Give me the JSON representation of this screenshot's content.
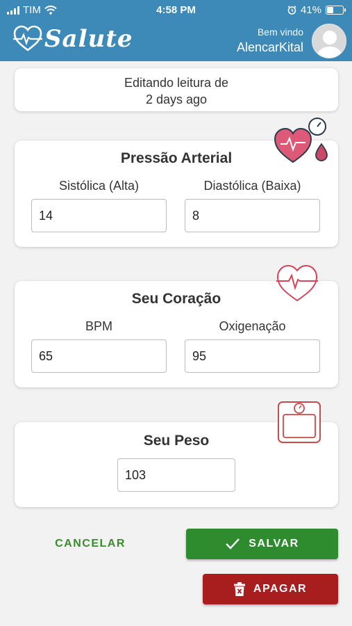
{
  "status_bar": {
    "carrier": "TIM",
    "time": "4:58 PM",
    "battery": "41%",
    "battery_level": 0.41,
    "icons": [
      "signal-icon",
      "wifi-icon",
      "alarm-icon",
      "battery-icon"
    ]
  },
  "header": {
    "app_name": "Salute",
    "welcome": "Bem vindo",
    "username": "AlencarKital",
    "background_color": "#3d8ab8"
  },
  "reading": {
    "line1": "Editando leitura de",
    "line2": "2 days ago"
  },
  "blood_pressure": {
    "title": "Pressão Arterial",
    "systolic_label": "Sistólica (Alta)",
    "systolic_value": "14",
    "diastolic_label": "Diastólica (Baixa)",
    "diastolic_value": "8",
    "icon": "heart-pressure-icon"
  },
  "heart": {
    "title": "Seu Coração",
    "bpm_label": "BPM",
    "bpm_value": "65",
    "oxygen_label": "Oxigenação",
    "oxygen_value": "95",
    "icon": "heartbeat-icon"
  },
  "weight": {
    "title": "Seu Peso",
    "value": "103",
    "icon": "scale-icon"
  },
  "actions": {
    "cancel": "CANCELAR",
    "save": "SALVAR",
    "delete": "APAGAR",
    "save_color": "#2e8b2e",
    "delete_color": "#a81d1d",
    "cancel_color": "#3a8a2e"
  }
}
